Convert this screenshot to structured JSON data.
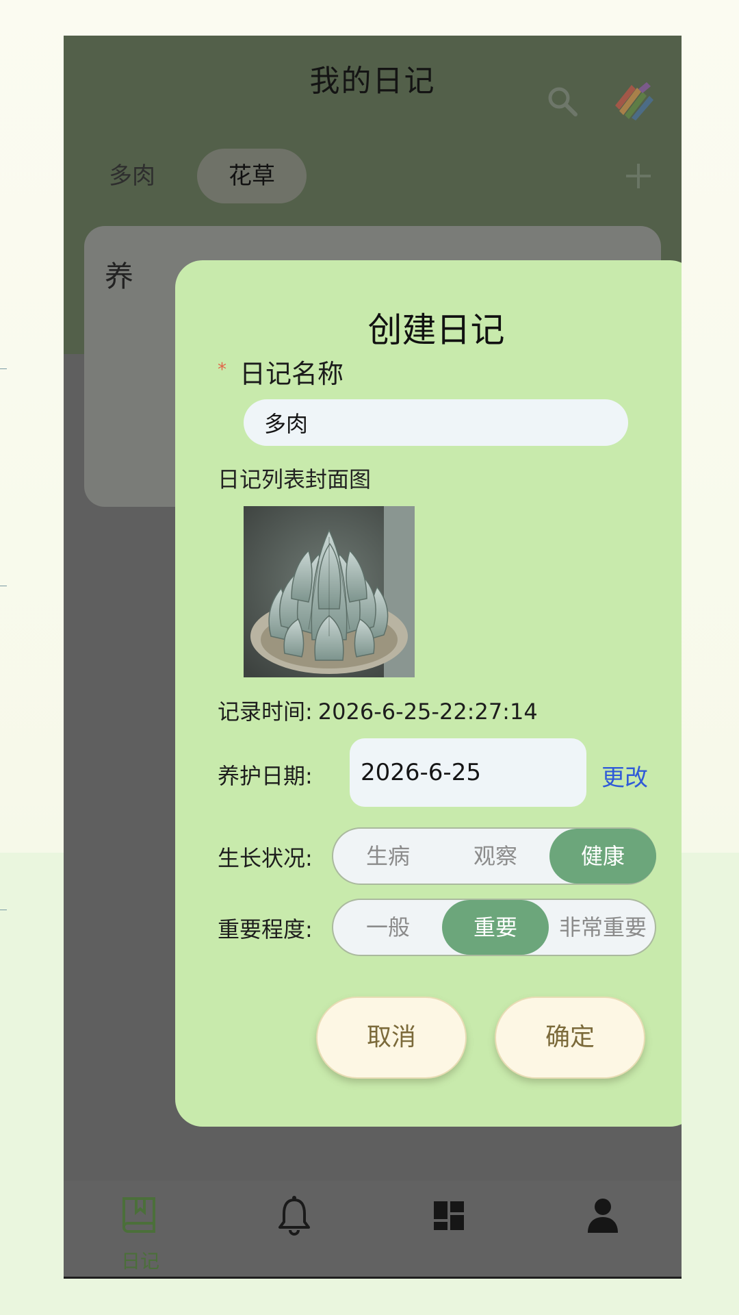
{
  "header": {
    "title": "我的日记",
    "tabs": [
      "多肉",
      "花草"
    ],
    "active_tab": 1
  },
  "background_card": {
    "title_fragment": "养"
  },
  "dialog": {
    "title": "创建日记",
    "required_mark": "*",
    "name_label": "日记名称",
    "name_value": "多肉",
    "cover_label": "日记列表封面图",
    "record_time_label": "记录时间:",
    "record_time_value": "2026-6-25-22:27:14",
    "care_date_label": "养护日期:",
    "care_date_value": "2026-6-25",
    "change_link": "更改",
    "growth_label": "生长状况:",
    "growth_options": [
      "生病",
      "观察",
      "健康"
    ],
    "growth_selected": "健康",
    "importance_label": "重要程度:",
    "importance_options": [
      "一般",
      "重要",
      "非常重要"
    ],
    "importance_selected": "重要",
    "cancel_label": "取消",
    "confirm_label": "确定"
  },
  "bottom_nav": {
    "items": [
      {
        "label": "日记",
        "icon": "book-icon",
        "active": true
      },
      {
        "label": "",
        "icon": "bell-icon",
        "active": false
      },
      {
        "label": "",
        "icon": "dashboard-icon",
        "active": false
      },
      {
        "label": "",
        "icon": "user-icon",
        "active": false
      }
    ]
  },
  "colors": {
    "header_bg": "#53604a",
    "dialog_bg": "#c8eaac",
    "selected_segment": "#6ca67b",
    "link": "#2f5ad8",
    "button_bg": "#fdf7e4"
  }
}
